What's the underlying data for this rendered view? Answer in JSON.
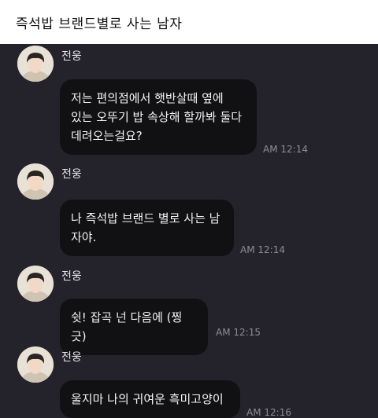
{
  "post": {
    "title": "즉석밥 브랜드별로 사는 남자"
  },
  "messages": [
    {
      "sender": "전웅",
      "text": "저는 편의점에서 햇반살때 옆에\n있는 오뚜기 밥 속상해 할까봐 둘다\n데려오는걸요?",
      "time": "AM 12:14"
    },
    {
      "sender": "전웅",
      "text": "나 즉석밥 브랜드 별로 사는 남\n자야.",
      "time": "AM 12:14"
    },
    {
      "sender": "전웅",
      "text": "쉿! 잡곡 넌 다음에 (찡긋)",
      "time": "AM 12:15"
    },
    {
      "sender": "전웅",
      "text": "울지마 나의 귀여운 흑미고양이",
      "time": "AM 12:16"
    }
  ],
  "colors": {
    "chat_background": "#24232b",
    "bubble_background": "#111114",
    "header_background": "#ffffff"
  },
  "icons": {
    "avatar": "profile-photo"
  }
}
